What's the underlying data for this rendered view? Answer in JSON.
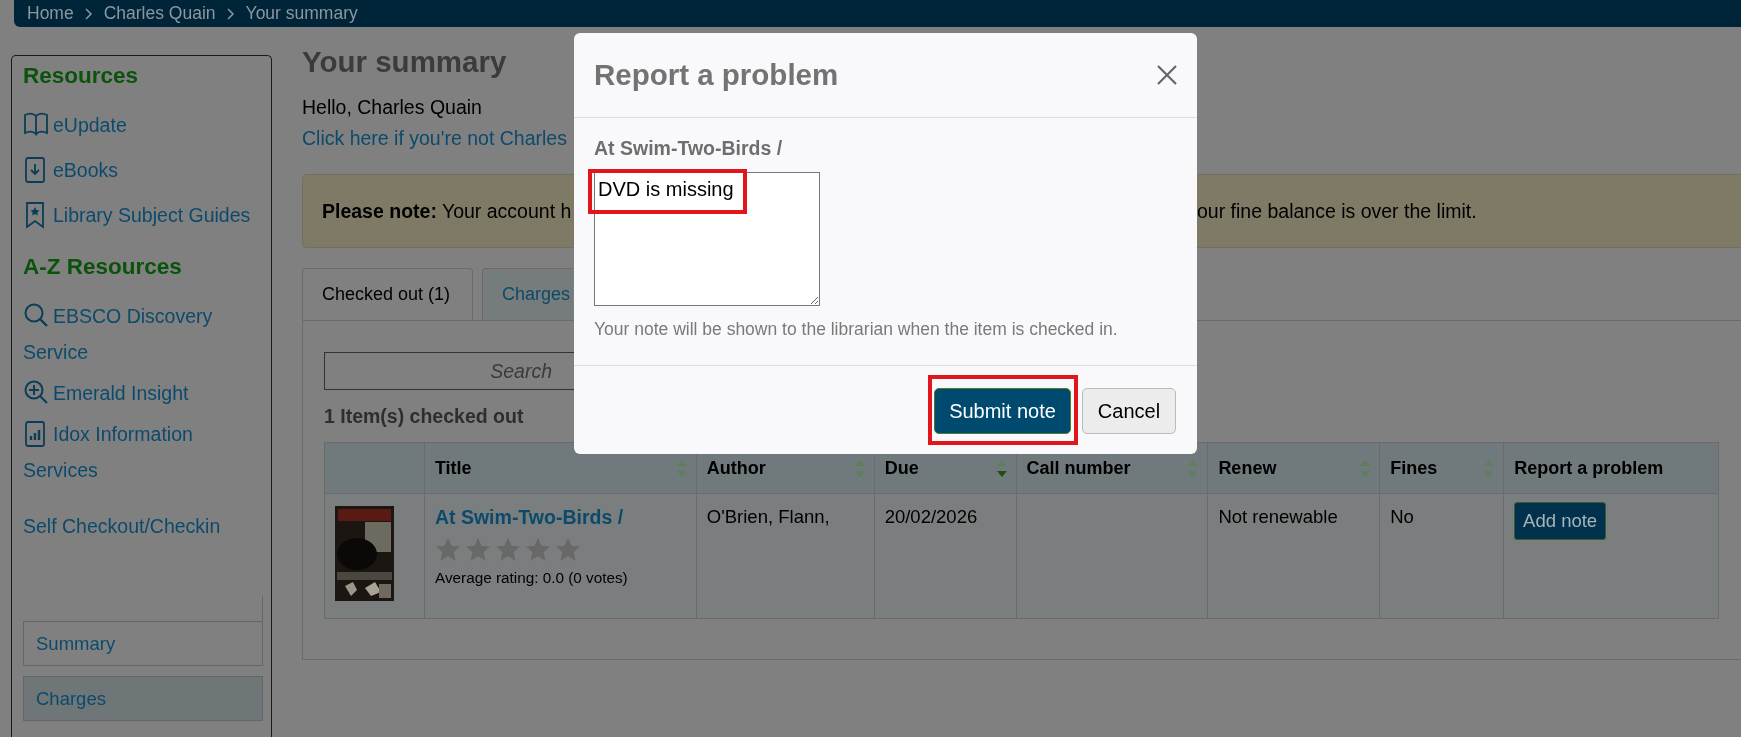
{
  "breadcrumb": [
    {
      "label": "Home"
    },
    {
      "label": "Charles Quain"
    },
    {
      "label": "Your summary"
    }
  ],
  "sidebar": {
    "sections": [
      {
        "heading": "Resources",
        "items": [
          {
            "label": "eUpdate"
          },
          {
            "label": "eBooks"
          },
          {
            "label": "Library Subject Guides"
          }
        ]
      },
      {
        "heading": "A-Z Resources",
        "items": [
          {
            "label": "EBSCO Discovery Service"
          },
          {
            "label": "Emerald Insight"
          },
          {
            "label": "Idox Information Services"
          }
        ]
      }
    ],
    "links": [
      {
        "label": "Self Checkout/Checkin"
      }
    ],
    "nav": [
      {
        "label": "Summary",
        "selected": true
      },
      {
        "label": "Charges",
        "selected": false
      }
    ]
  },
  "main": {
    "title": "Your summary",
    "greeting": "Hello, Charles Quain",
    "switch_link": "Click here if you're not Charles",
    "notice": {
      "left": "**Please note:** Your account h",
      "right": "our fine balance is over the limit."
    },
    "tabs": [
      {
        "label": "Checked out (1)",
        "selected": true
      },
      {
        "label": "Charges",
        "selected": false
      }
    ],
    "search": {
      "placeholder": "Search"
    },
    "count": "1 Item(s) checked out",
    "table": {
      "columns": [
        {
          "kind": "plain"
        },
        {
          "label": "Title",
          "kind": "sortable",
          "sorted": false
        },
        {
          "label": "Author",
          "kind": "sortable",
          "sorted": false
        },
        {
          "label": "Due",
          "kind": "sortable",
          "sorted": true
        },
        {
          "label": "Call number",
          "kind": "sortable",
          "sorted": false
        },
        {
          "label": "Renew",
          "kind": "sortable",
          "sorted": false
        },
        {
          "label": "Fines",
          "kind": "sortable",
          "sorted": false
        },
        {
          "label": "Report a problem",
          "kind": "plain"
        }
      ],
      "rows": [
        {
          "title": "At Swim-Two-Birds /",
          "stars": 0,
          "rating": "Average rating: 0.0 (0 votes)",
          "author": "O'Brien, Flann,",
          "due": "20/02/2026",
          "renew": "Not renewable",
          "fines": "No",
          "action": "Add note"
        }
      ]
    }
  },
  "modal": {
    "title": "Report a problem",
    "item_title": "At Swim-Two-Birds /",
    "note": {
      "value": "DVD is missing",
      "highlighted": true
    },
    "hint": "Your note will be shown to the librarian when the item is checked in.",
    "buttons": [
      {
        "label": "Submit note",
        "kind": "primary",
        "highlighted": true
      },
      {
        "label": "Cancel",
        "kind": "default",
        "highlighted": false
      }
    ]
  }
}
